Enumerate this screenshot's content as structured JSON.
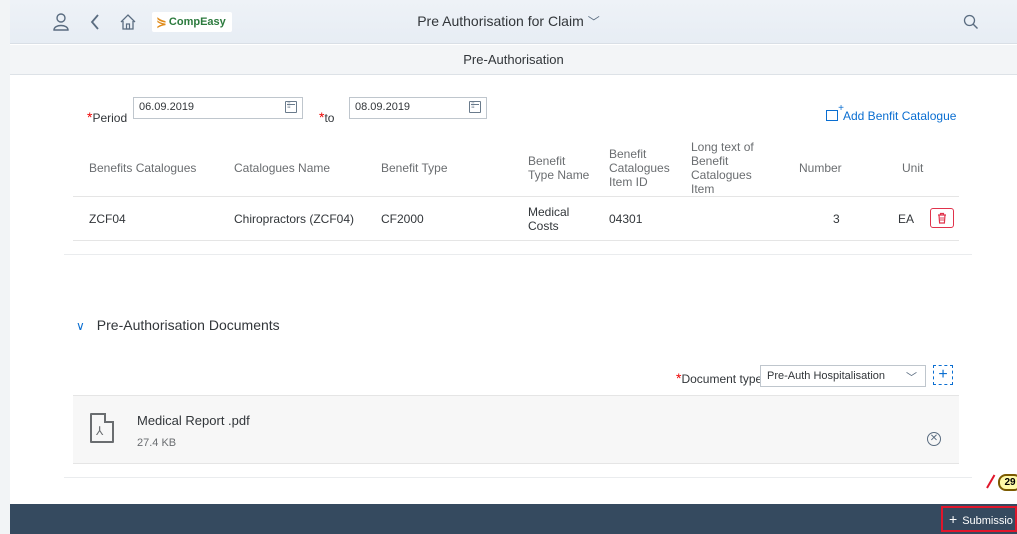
{
  "shell": {
    "brand": "CompEasy",
    "title": "Pre Authorisation for Claim"
  },
  "page": {
    "header": "Pre-Authorisation"
  },
  "filters": {
    "period_label": "Period",
    "period_from": "06.09.2019",
    "to_label": "to",
    "period_to": "08.09.2019",
    "add_catalogue_label": "Add Benfit Catalogue"
  },
  "table": {
    "headers": [
      "Benefits Catalogues",
      "Catalogues Name",
      "Benefit Type",
      "Benefit Type Name",
      "Benefit Catalogues Item ID",
      "Long text of Benefit Catalogues Item",
      "Number",
      "Unit"
    ],
    "rows": [
      {
        "catalogue": "ZCF04",
        "name": "Chiropractors (ZCF04)",
        "type": "CF2000",
        "type_name": "Medical Costs",
        "item_id": "04301",
        "long_text": "",
        "number": "3",
        "unit": "EA"
      }
    ]
  },
  "documents": {
    "section_title": "Pre-Authorisation Documents",
    "doc_type_label": "Document type",
    "doc_type_value": "Pre-Auth Hospitalisation",
    "files": [
      {
        "name": "Medical Report .pdf",
        "size": "27.4 KB"
      }
    ]
  },
  "footer": {
    "submit_label": "Submissio",
    "step_badge": "29"
  },
  "colors": {
    "accent": "#0a6ed1",
    "footer_bg": "#354a5f",
    "highlight": "#e0162b"
  }
}
